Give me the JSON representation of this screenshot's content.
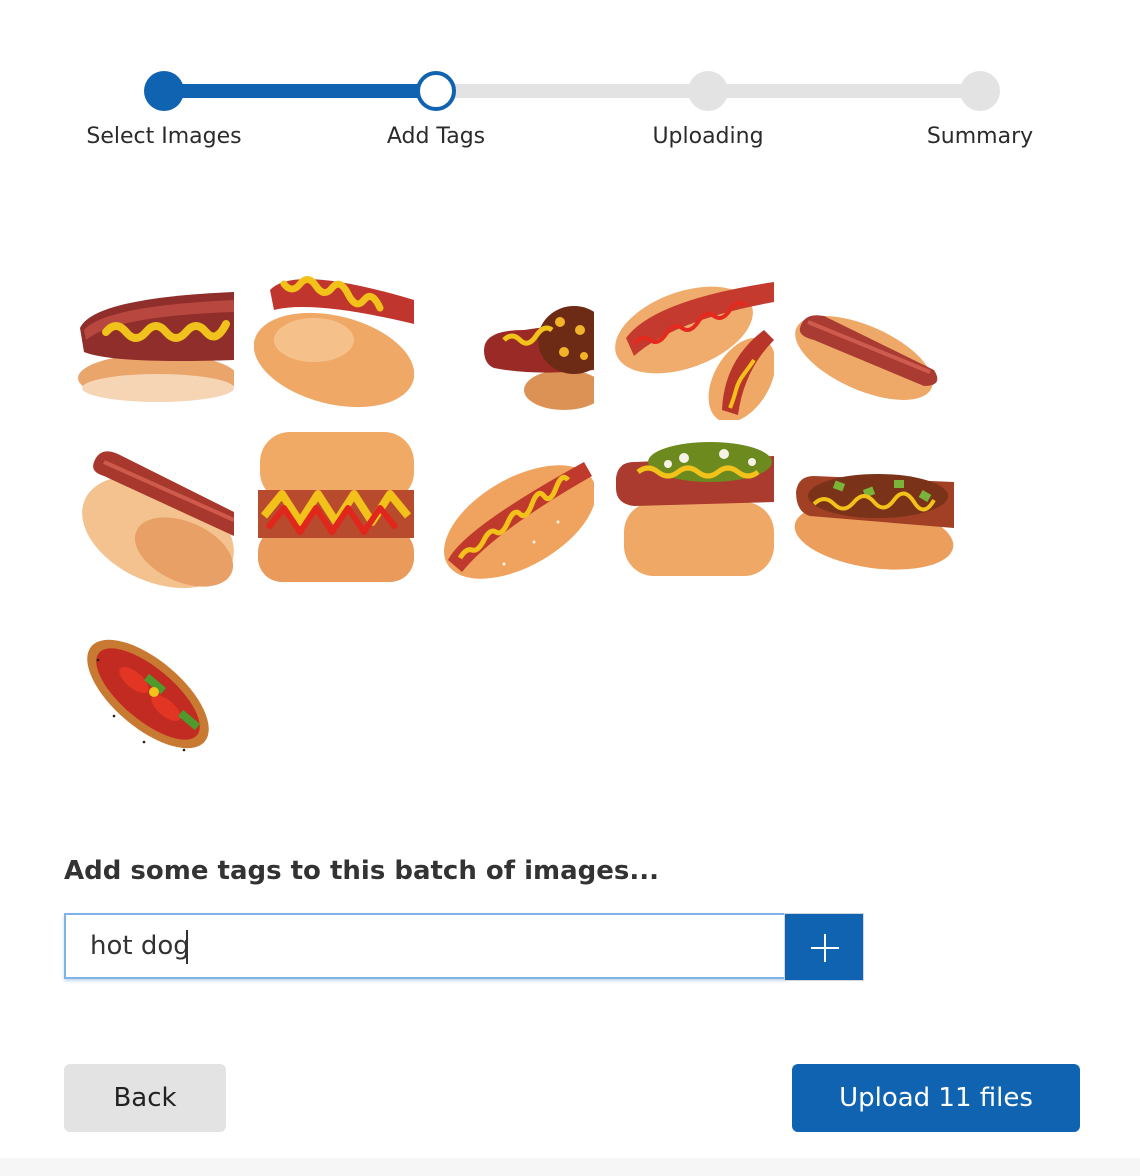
{
  "stepper": {
    "steps": [
      {
        "label": "Select Images",
        "state": "completed"
      },
      {
        "label": "Add Tags",
        "state": "current"
      },
      {
        "label": "Uploading",
        "state": "upcoming"
      },
      {
        "label": "Summary",
        "state": "upcoming"
      }
    ]
  },
  "images": {
    "count": 11,
    "items": [
      {
        "name": "hotdog-mustard-side"
      },
      {
        "name": "hotdog-mustard-angle"
      },
      {
        "name": "chili-dog-cheese"
      },
      {
        "name": "hotdogs-ketchup-mustard-pair"
      },
      {
        "name": "plain-hotdog"
      },
      {
        "name": "plain-hotdog-closeup"
      },
      {
        "name": "hotdog-ketchup-mustard-zigzag"
      },
      {
        "name": "hotdog-sesame-bun-ketchup"
      },
      {
        "name": "hotdog-relish-onion"
      },
      {
        "name": "chili-dog-peppers"
      },
      {
        "name": "chicago-style-hotdog"
      }
    ]
  },
  "tags": {
    "heading": "Add some tags to this batch of images...",
    "input_value": "hot dog",
    "add_icon": "plus-icon"
  },
  "footer": {
    "back_label": "Back",
    "upload_label": "Upload 11 files"
  },
  "colors": {
    "accent": "#0f63b1",
    "track_inactive": "#e3e3e3",
    "input_border": "#7fb2e6"
  }
}
